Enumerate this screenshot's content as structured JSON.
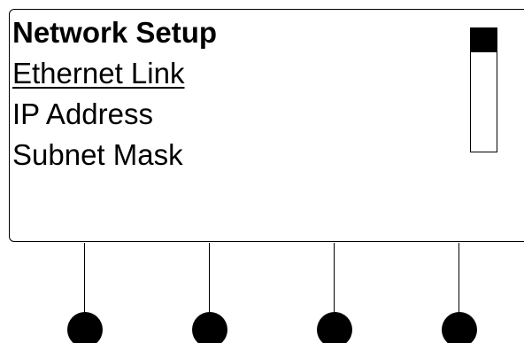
{
  "screen": {
    "title": "Network Setup",
    "items": [
      {
        "label": "Ethernet Link",
        "selected": true
      },
      {
        "label": "IP Address",
        "selected": false
      },
      {
        "label": "Subnet Mask",
        "selected": false
      }
    ],
    "scroll_position": 0.2
  },
  "softkeys": [
    {
      "id": "softkey-1"
    },
    {
      "id": "softkey-2"
    },
    {
      "id": "softkey-3"
    },
    {
      "id": "softkey-4"
    }
  ],
  "colors": {
    "foreground": "#000000",
    "background": "#ffffff"
  }
}
